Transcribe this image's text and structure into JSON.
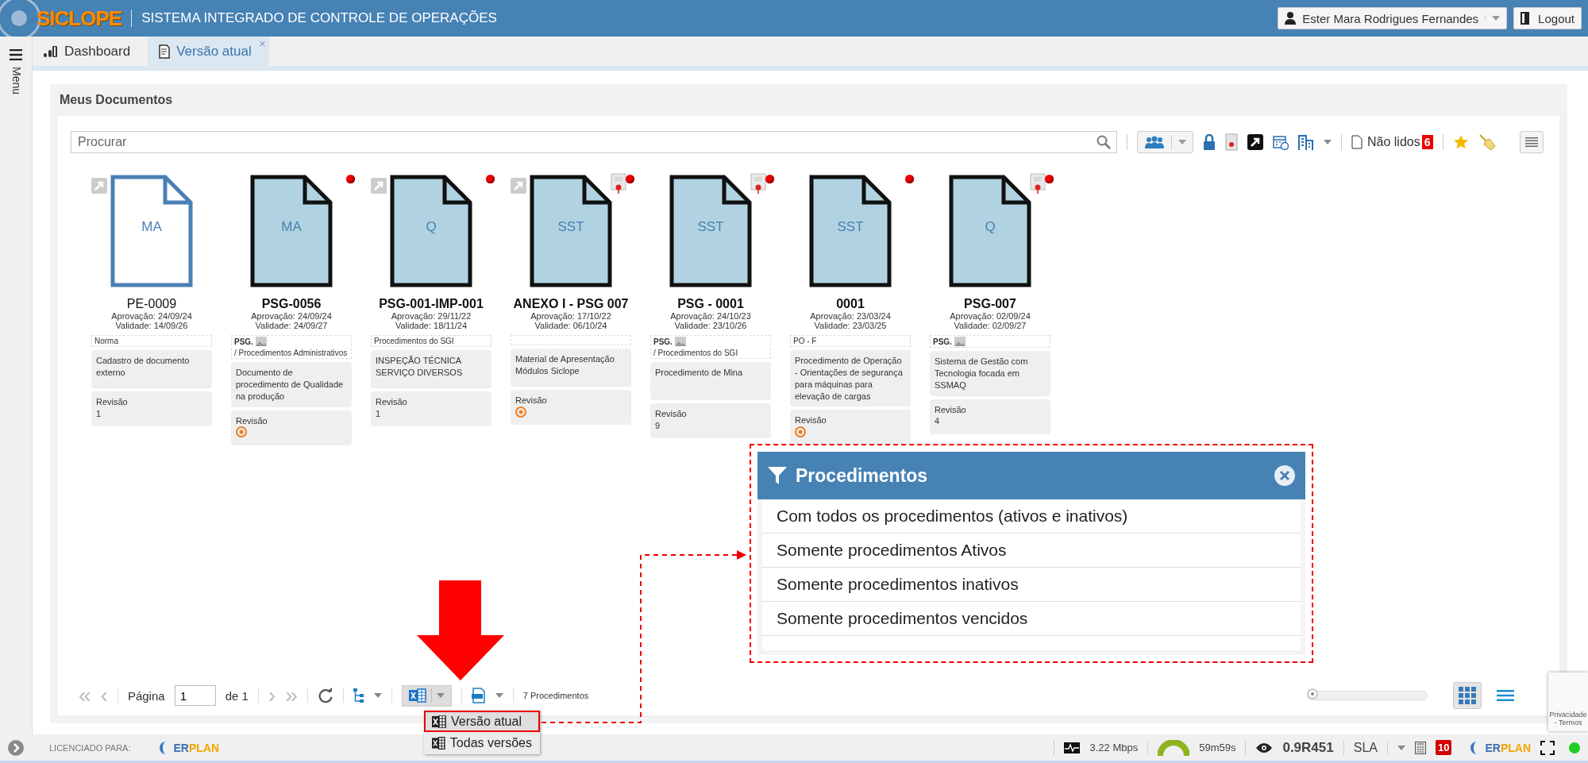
{
  "header": {
    "logo": "SICLOPE",
    "title": "SISTEMA INTEGRADO DE CONTROLE DE OPERAÇÕES",
    "user": "Ester Mara Rodrigues Fernandes",
    "logout": "Logout"
  },
  "sidebar": {
    "label": "Menu"
  },
  "tabs": [
    {
      "label": "Dashboard",
      "selected": false,
      "closable": false
    },
    {
      "label": "Versão atual",
      "selected": true,
      "closable": true
    }
  ],
  "close_glyph": "×",
  "panel": {
    "title": "Meus Documentos"
  },
  "search": {
    "placeholder": "Procurar"
  },
  "toolbar": {
    "unread_label": "Não lidos",
    "unread_count": "6"
  },
  "documents": [
    {
      "kind": "outline",
      "type": "MA",
      "code": "PE-0009",
      "approval": "Aprovação: 24/09/24",
      "validity": "Validade: 14/09/26",
      "shortcut": true,
      "unread": false,
      "certificate": false,
      "category": {
        "text": "Norma"
      },
      "description": "Cadastro de documento externo",
      "revision_label": "Revisão",
      "revision": "1",
      "revision_pending": false
    },
    {
      "kind": "filled",
      "type": "MA",
      "code": "PSG-0056",
      "approval": "Aprovação: 24/09/24",
      "validity": "Validade: 24/09/27",
      "shortcut": false,
      "unread": true,
      "certificate": false,
      "category": {
        "prefix": "PSG.",
        "text": "/ Procedimentos Administrativos"
      },
      "description": "Documento de procedimento de Qualidade na produção",
      "revision_label": "Revisão",
      "revision_pending": true
    },
    {
      "kind": "filled",
      "type": "Q",
      "code": "PSG-001-IMP-001",
      "approval": "Aprovação: 29/11/22",
      "validity": "Validade: 18/11/24",
      "shortcut": true,
      "unread": true,
      "certificate": false,
      "category": {
        "text": "Procedimentos do SGI"
      },
      "description": "INSPEÇÃO TÉCNICA SERVIÇO DIVERSOS",
      "revision_label": "Revisão",
      "revision": "1",
      "revision_pending": false
    },
    {
      "kind": "filled",
      "type": "SST",
      "code": "ANEXO I - PSG 007",
      "approval": "Aprovação: 17/10/22",
      "validity": "Validade: 06/10/24",
      "shortcut": true,
      "unread": true,
      "certificate": true,
      "description": "Material de Apresentação Módulos Siclope",
      "revision_label": "Revisão",
      "revision_pending": true
    },
    {
      "kind": "filled",
      "type": "SST",
      "code": "PSG - 0001",
      "approval": "Aprovação: 24/10/23",
      "validity": "Validade: 23/10/26",
      "shortcut": false,
      "unread": true,
      "certificate": true,
      "category": {
        "prefix": "PSG.",
        "text": "/ Procedimentos do SGI"
      },
      "description": "Procedimento de Mina",
      "revision_label": "Revisão",
      "revision": "9",
      "revision_pending": false
    },
    {
      "kind": "filled",
      "type": "SST",
      "code": "0001",
      "approval": "Aprovação: 23/03/24",
      "validity": "Validade: 23/03/25",
      "shortcut": false,
      "unread": true,
      "certificate": false,
      "category": {
        "text": "PO - F"
      },
      "description": "Procedimento de Operação - Orientações de segurança para máquinas para elevação de cargas",
      "revision_label": "Revisão",
      "revision_pending": true
    },
    {
      "kind": "filled",
      "type": "Q",
      "code": "PSG-007",
      "approval": "Aprovação: 02/09/24",
      "validity": "Validade: 02/09/27",
      "shortcut": false,
      "unread": true,
      "certificate": true,
      "category": {
        "prefix": "PSG."
      },
      "description": "Sistema de Gestão com Tecnologia focada em SSMAQ",
      "revision_label": "Revisão",
      "revision": "4",
      "revision_pending": false
    }
  ],
  "pager": {
    "first": "«",
    "prev": "‹",
    "page_label": "Página",
    "page": "1",
    "of": "de 1",
    "next": "›",
    "last": "»",
    "count": "7 Procedimentos"
  },
  "view": {
    "zoom": {
      "level": 0.02
    },
    "grid_selected": true,
    "list_selected": false
  },
  "export_menu": [
    {
      "label": "Versão atual",
      "highlighted": true
    },
    {
      "label": "Todas versões",
      "highlighted": false
    }
  ],
  "filter_popup": {
    "title": "Procedimentos",
    "options": [
      "Com todos os procedimentos (ativos e inativos)",
      "Somente procedimentos Ativos",
      "Somente procedimentos inativos",
      "Somente procedimentos vencidos"
    ]
  },
  "recaptcha": {
    "text": "Privacidade - Termos"
  },
  "footer": {
    "licensed": "LICENCIADO PARA:",
    "licensee_logo": {
      "a": "ER",
      "b": "PLAN"
    },
    "vendor_logo": {
      "a": "ER",
      "b": "PLAN"
    },
    "speed": "3.22 Mbps",
    "session": "59m59s",
    "version": "0.9R451",
    "sla": "SLA",
    "alerts": "10",
    "online": true
  }
}
